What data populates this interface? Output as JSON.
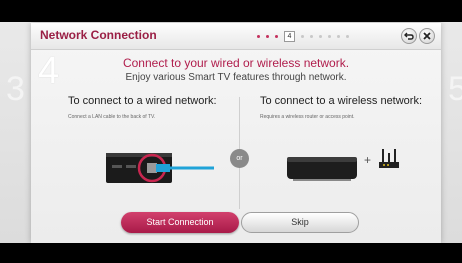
{
  "window": {
    "title": "Network Connection",
    "current_step": "4",
    "side_prev_step": "3",
    "side_next_step": "5",
    "steps_done": 3,
    "steps_todo": 6
  },
  "headline": "Connect to your wired or wireless network.",
  "subline": "Enjoy various Smart TV features through network.",
  "wired": {
    "heading": "To connect to a wired network:",
    "instruction": "Connect a LAN cable to the back of TV."
  },
  "wireless": {
    "heading": "To connect to a wireless network:",
    "instruction": "Requires a wireless router or access point."
  },
  "or_label": "or",
  "plus_label": "+",
  "buttons": {
    "start": "Start Connection",
    "skip": "Skip"
  },
  "colors": {
    "accent": "#b01d4c",
    "title": "#9a1f45",
    "cable": "#1fa3d8"
  },
  "icons": [
    "back-icon",
    "close-icon",
    "tv-lan-port-icon",
    "ethernet-cable-icon",
    "settop-box-icon",
    "router-icon"
  ]
}
